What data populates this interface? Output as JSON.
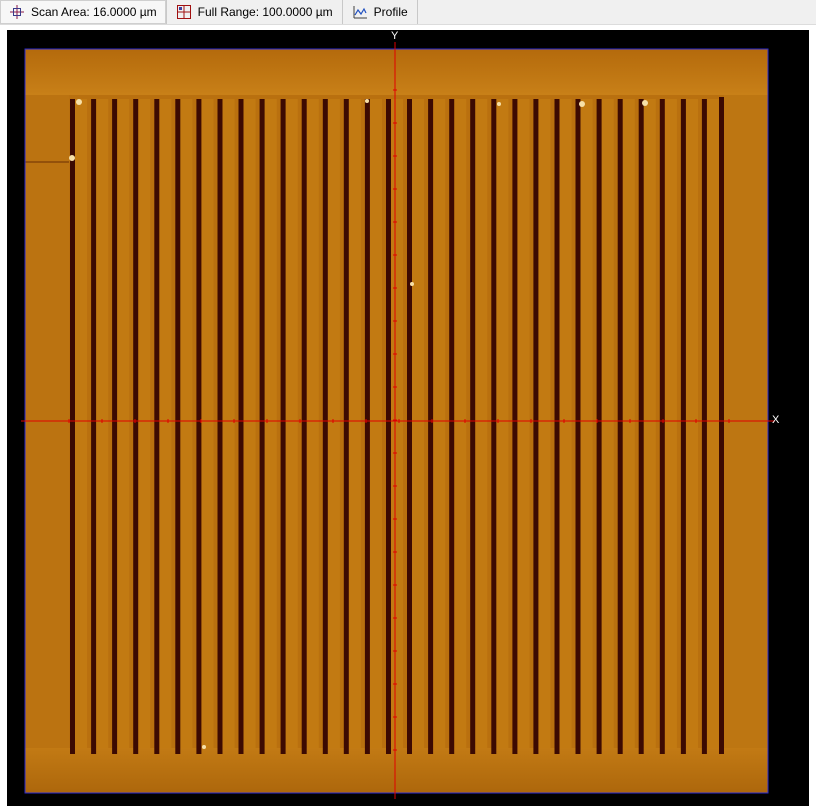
{
  "toolbar": {
    "tabs": [
      {
        "label": "Scan Area: 16.0000 µm",
        "icon": "crosshair-icon"
      },
      {
        "label": "Full Range: 100.0000 µm",
        "icon": "grid-icon"
      },
      {
        "label": "Profile",
        "icon": "profile-chart-icon"
      }
    ]
  },
  "viewer": {
    "x_axis_label": "X",
    "y_axis_label": "Y",
    "colors": {
      "substrate": "#b86e0e",
      "stripe_light": "#c27a12",
      "trench": "#3c0a02",
      "frame": "#2a2ad0",
      "crosshair": "#e00000",
      "background": "#000000"
    }
  }
}
